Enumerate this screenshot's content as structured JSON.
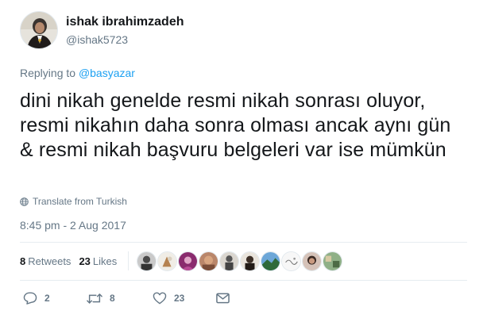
{
  "tweet": {
    "author": {
      "display_name": "ishak ibrahimzadeh",
      "handle": "@ishak5723"
    },
    "reply_prefix": "Replying to",
    "reply_to": "@basyazar",
    "text": "dini nikah genelde resmi nikah sonrası oluyor, resmi nikahın daha sonra olması ancak aynı gün & resmi nikah başvuru belgeleri var ise mümkün",
    "translate_label": "Translate from Turkish",
    "timestamp": "8:45 pm - 2 Aug 2017",
    "stats": {
      "retweets_count": "8",
      "retweets_label": "Retweets",
      "likes_count": "23",
      "likes_label": "Likes"
    },
    "actions": {
      "reply_count": "2",
      "retweet_count": "8",
      "like_count": "23"
    }
  },
  "colors": {
    "text_primary": "#14171a",
    "text_secondary": "#657786",
    "link": "#1da1f2",
    "divider": "#e6ecf0"
  },
  "icons": [
    "globe-icon",
    "reply-icon",
    "retweet-icon",
    "heart-icon",
    "envelope-icon"
  ]
}
